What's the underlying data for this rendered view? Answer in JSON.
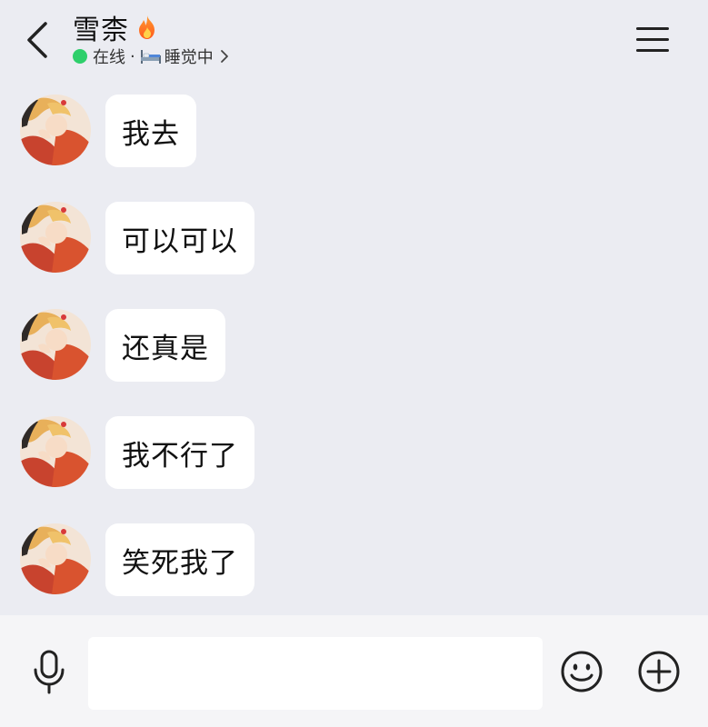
{
  "header": {
    "title": "雪柰",
    "status": "在线",
    "separator": "·",
    "activity": "睡觉中"
  },
  "colors": {
    "background": "#ebecf2",
    "bubble": "#ffffff",
    "online": "#2ecf6b",
    "input_bar": "#f5f5f7"
  },
  "messages": [
    {
      "text": "我去"
    },
    {
      "text": "可以可以"
    },
    {
      "text": "还真是"
    },
    {
      "text": "我不行了"
    },
    {
      "text": "笑死我了"
    }
  ],
  "input": {
    "value": "",
    "placeholder": ""
  },
  "icons": {
    "back": "chevron-left-icon",
    "fire": "fire-icon",
    "bed": "bed-icon",
    "status_more": "chevron-right-icon",
    "menu": "hamburger-menu-icon",
    "voice": "microphone-icon",
    "emoji": "smiley-icon",
    "more": "plus-circle-icon"
  }
}
